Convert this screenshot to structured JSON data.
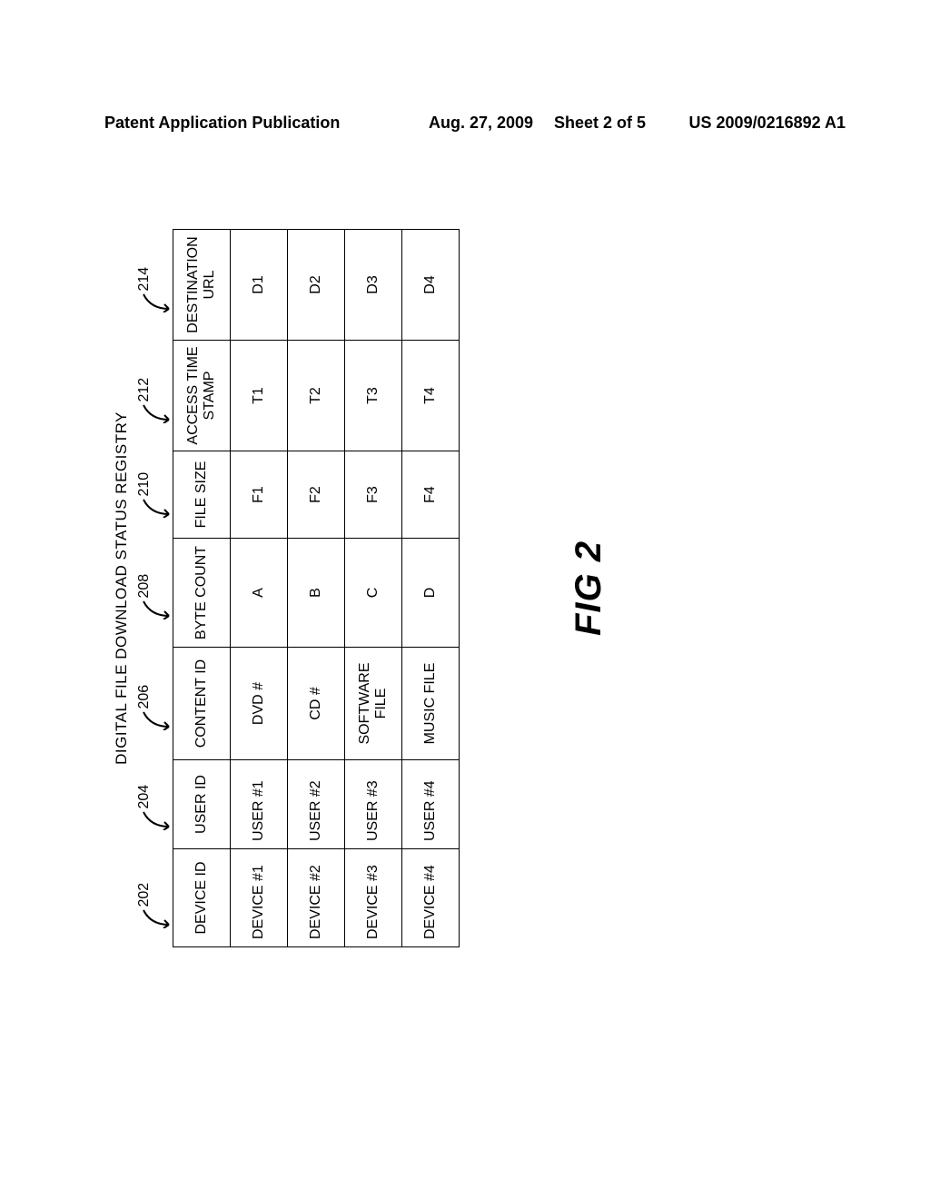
{
  "header": {
    "left": "Patent Application Publication",
    "date": "Aug. 27, 2009",
    "sheet": "Sheet 2 of 5",
    "pubno": "US 2009/0216892 A1"
  },
  "figure": {
    "title": "DIGITAL FILE DOWNLOAD STATUS REGISTRY",
    "caption": "FIG 2",
    "callouts": [
      "202",
      "204",
      "206",
      "208",
      "210",
      "212",
      "214"
    ],
    "columns": [
      "DEVICE ID",
      "USER ID",
      "CONTENT ID",
      "BYTE COUNT",
      "FILE SIZE",
      "ACCESS TIME STAMP",
      "DESTINATION URL"
    ],
    "rows": [
      {
        "device": "DEVICE #1",
        "user": "USER #1",
        "content": "DVD #",
        "byte": "A",
        "size": "F1",
        "time": "T1",
        "dest": "D1"
      },
      {
        "device": "DEVICE #2",
        "user": "USER #2",
        "content": "CD #",
        "byte": "B",
        "size": "F2",
        "time": "T2",
        "dest": "D2"
      },
      {
        "device": "DEVICE #3",
        "user": "USER #3",
        "content": "SOFTWARE FILE",
        "byte": "C",
        "size": "F3",
        "time": "T3",
        "dest": "D3"
      },
      {
        "device": "DEVICE #4",
        "user": "USER #4",
        "content": "MUSIC FILE",
        "byte": "D",
        "size": "F4",
        "time": "T4",
        "dest": "D4"
      }
    ]
  }
}
